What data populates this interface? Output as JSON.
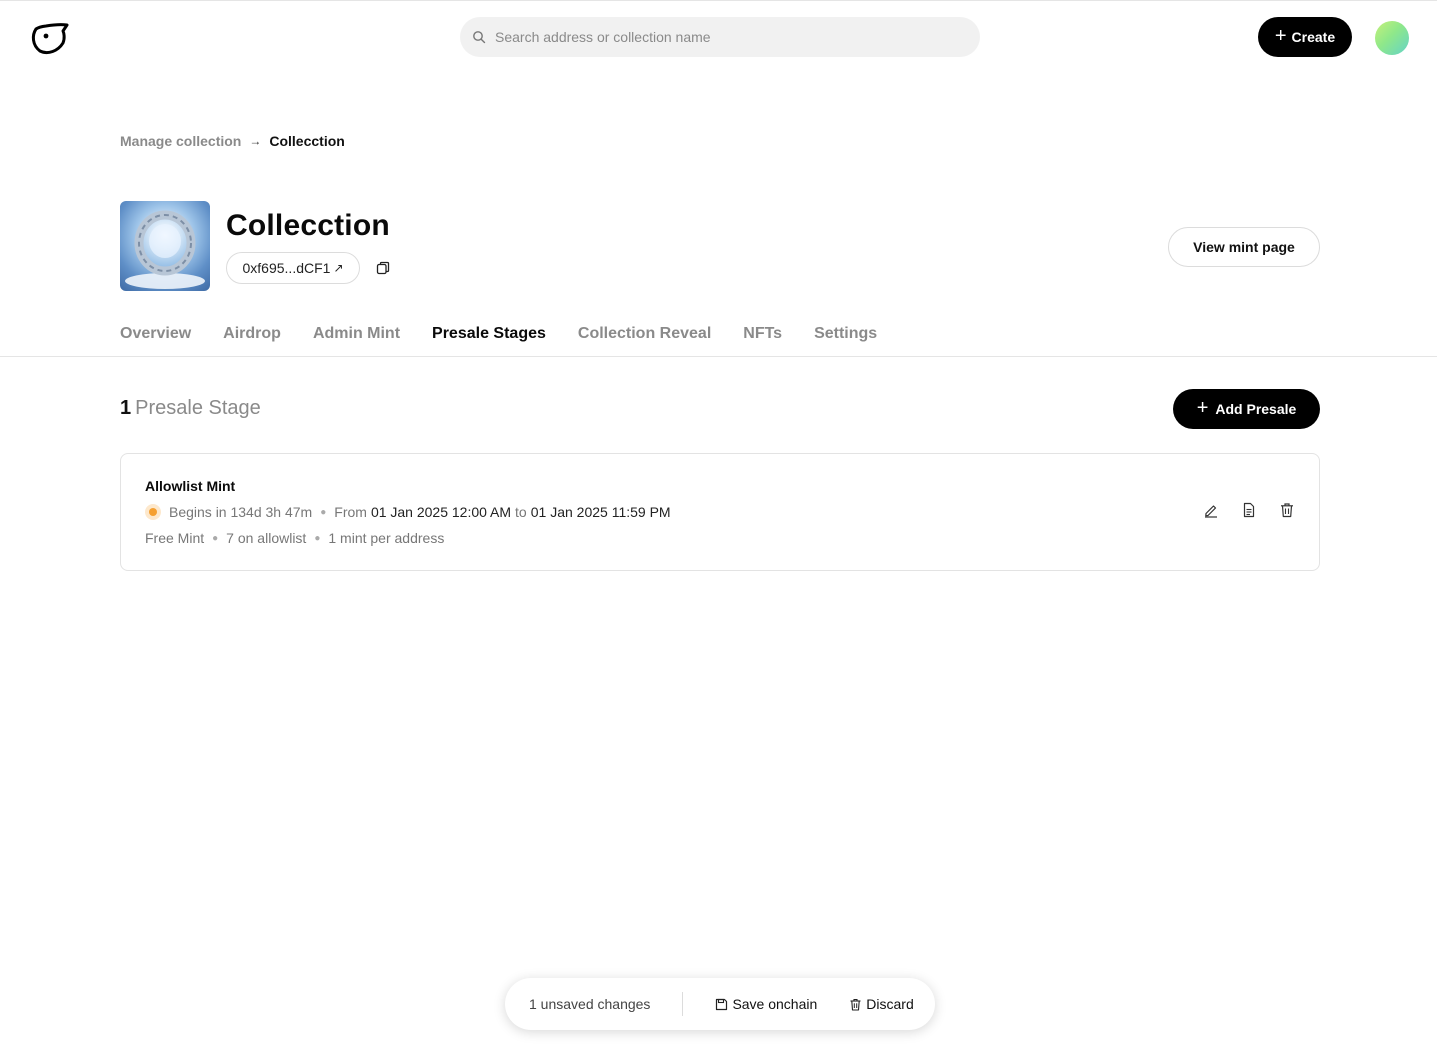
{
  "header": {
    "search_placeholder": "Search address or collection name",
    "create_label": "Create"
  },
  "breadcrumb": {
    "parent": "Manage collection",
    "current": "Collecction"
  },
  "collection": {
    "title": "Collecction",
    "address": "0xf695...dCF1",
    "view_mint_label": "View mint page"
  },
  "tabs": [
    {
      "label": "Overview",
      "active": false
    },
    {
      "label": "Airdrop",
      "active": false
    },
    {
      "label": "Admin Mint",
      "active": false
    },
    {
      "label": "Presale Stages",
      "active": true
    },
    {
      "label": "Collection Reveal",
      "active": false
    },
    {
      "label": "NFTs",
      "active": false
    },
    {
      "label": "Settings",
      "active": false
    }
  ],
  "presale": {
    "count": "1",
    "count_label": "Presale Stage",
    "add_label": "Add Presale",
    "stages": [
      {
        "name": "Allowlist Mint",
        "begins": "Begins in 134d 3h 47m",
        "from_label": "From",
        "start": "01 Jan 2025 12:00 AM",
        "to_label": "to",
        "end": "01 Jan 2025 11:59 PM",
        "price": "Free Mint",
        "allowlist": "7 on allowlist",
        "limit": "1 mint per address",
        "status_color": "#f5a032"
      }
    ]
  },
  "unsaved": {
    "text": "1 unsaved changes",
    "save_label": "Save onchain",
    "discard_label": "Discard"
  },
  "colors": {
    "primary": "#000000",
    "muted_text": "#8a8a8a",
    "border": "#e3e3e3"
  },
  "icons": [
    "bird-logo-icon",
    "search-icon",
    "plus-icon",
    "external-link-icon",
    "copy-icon",
    "arrow-right-icon",
    "edit-icon",
    "document-icon",
    "trash-icon",
    "save-icon"
  ]
}
